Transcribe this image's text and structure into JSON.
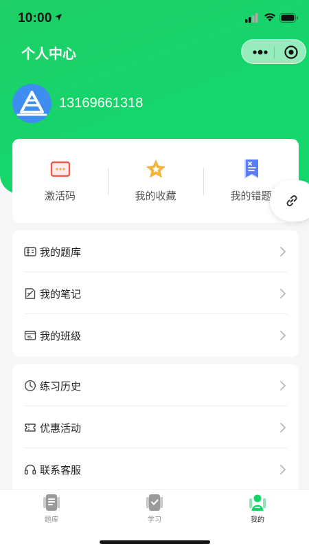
{
  "status": {
    "time": "10:00"
  },
  "nav": {
    "title": "个人中心"
  },
  "user": {
    "id": "13169661318"
  },
  "quick": [
    {
      "label": "激活码",
      "icon": "ticket-code-icon"
    },
    {
      "label": "我的收藏",
      "icon": "star-icon"
    },
    {
      "label": "我的错题",
      "icon": "wrong-bookmark-icon"
    }
  ],
  "menu1": [
    {
      "label": "我的题库",
      "icon": "question-bank-icon"
    },
    {
      "label": "我的笔记",
      "icon": "note-icon"
    },
    {
      "label": "我的班级",
      "icon": "class-icon"
    }
  ],
  "menu2": [
    {
      "label": "练习历史",
      "icon": "clock-icon"
    },
    {
      "label": "优惠活动",
      "icon": "coupon-icon"
    },
    {
      "label": "联系客服",
      "icon": "headset-icon"
    }
  ],
  "tabs": [
    {
      "label": "题库",
      "icon": "book-icon"
    },
    {
      "label": "学习",
      "icon": "study-icon"
    },
    {
      "label": "我的",
      "icon": "profile-icon",
      "active": true
    }
  ],
  "colors": {
    "brand": "#17D46A",
    "avatar": "#3E8EF0",
    "wrong": "#5B7CF6",
    "star": "#F5B53B",
    "code": "#E85D4F"
  }
}
